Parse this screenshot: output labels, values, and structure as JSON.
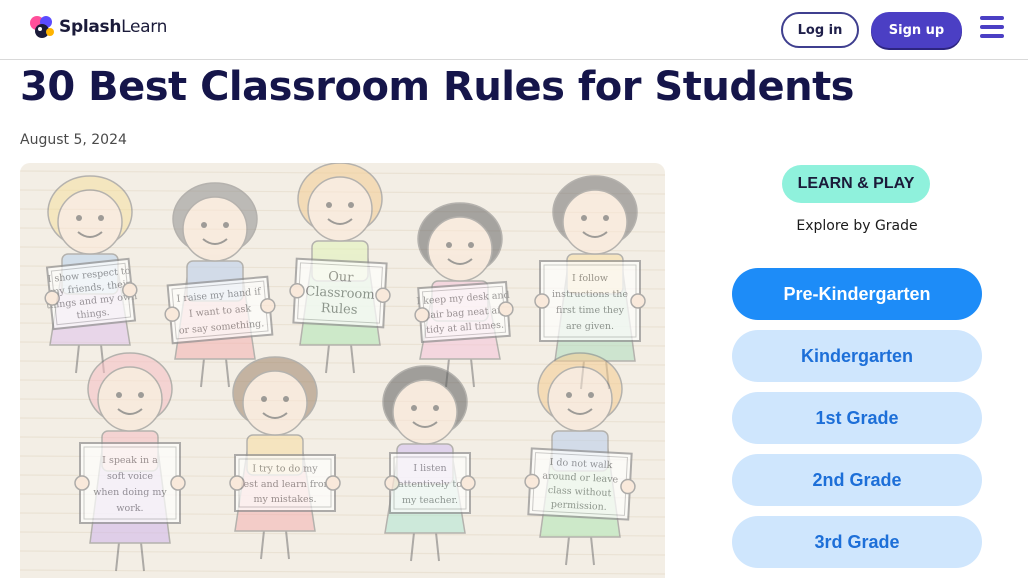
{
  "header": {
    "brand_bold": "Splash",
    "brand_light": "Learn",
    "login_label": "Log in",
    "signup_label": "Sign up",
    "menu_icon": "hamburger-menu-icon"
  },
  "article": {
    "title": "30 Best Classroom Rules for Students",
    "date": "August 5, 2024",
    "illustration": {
      "signs": [
        [
          "I show respect to",
          "my friends, their",
          "things and my own",
          "things."
        ],
        [
          "I raise my hand if",
          "I want to ask",
          "or say something."
        ],
        [
          "Our",
          "Classroom",
          "Rules"
        ],
        [
          "I keep my desk and",
          "chair bag neat and",
          "tidy at all times."
        ],
        [
          "I follow",
          "instructions the",
          "first time they",
          "are given."
        ],
        [
          "I speak in a",
          "soft voice",
          "when doing my",
          "work."
        ],
        [
          "I try to do my",
          "best and learn from",
          "my mistakes."
        ],
        [
          "I listen",
          "attentively to",
          "my teacher."
        ],
        [
          "I do not walk",
          "around or leave",
          "class without",
          "permission."
        ]
      ]
    }
  },
  "sidebar": {
    "badge": "LEARN & PLAY",
    "explore": "Explore by Grade",
    "grades": [
      "Pre-Kindergarten",
      "Kindergarten",
      "1st Grade",
      "2nd Grade",
      "3rd Grade"
    ]
  },
  "colors": {
    "brand_purple": "#4b3fc4",
    "title_navy": "#15154a",
    "badge_mint": "#8ff1dc",
    "grade_active": "#1d8cf8",
    "grade_inactive": "#cfe6fd"
  }
}
